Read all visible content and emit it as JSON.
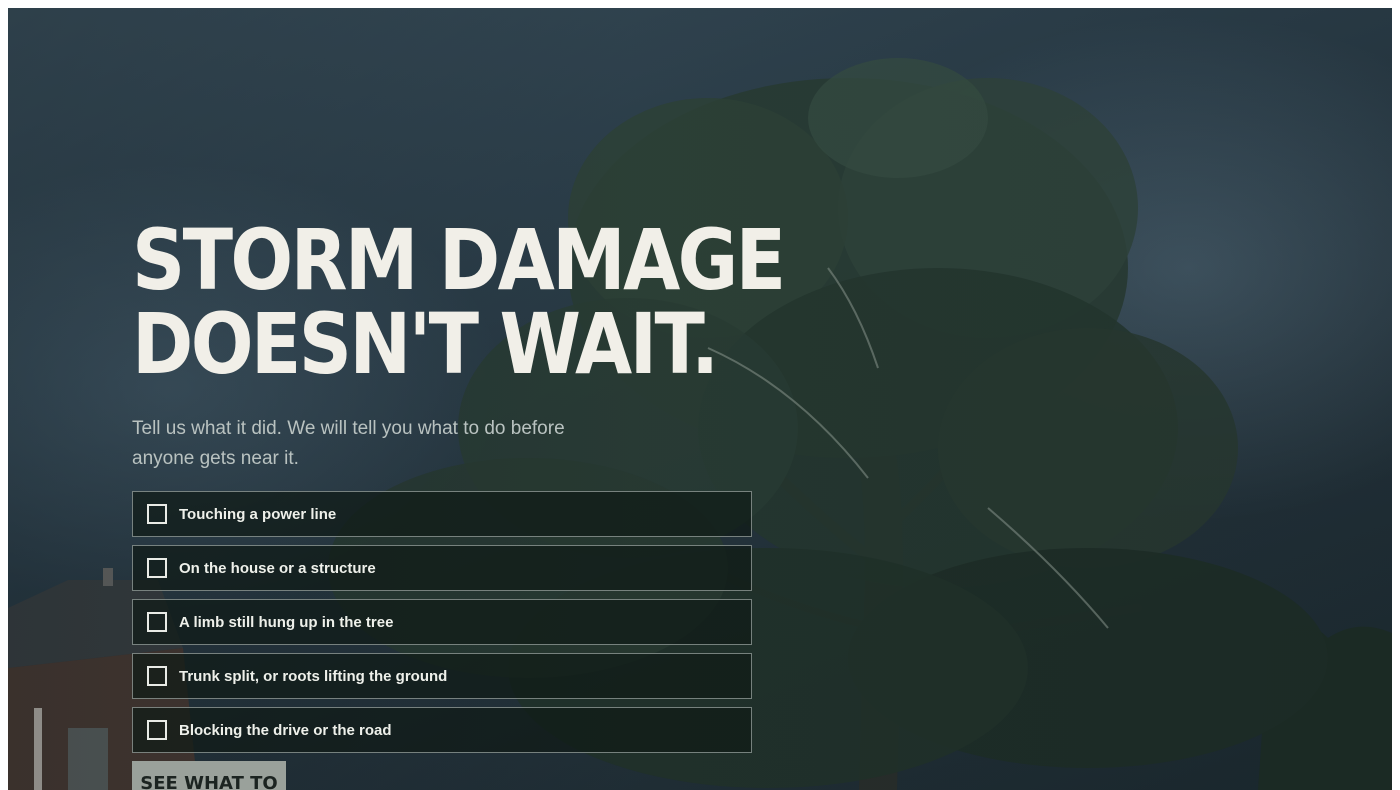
{
  "hero": {
    "headline_line1": "STORM DAMAGE",
    "headline_line2": "DOESN'T WAIT.",
    "subtitle": "Tell us what it did. We will tell you what to do before anyone gets near it."
  },
  "options": [
    {
      "label": "Touching a power line",
      "checked": false
    },
    {
      "label": "On the house or a structure",
      "checked": false
    },
    {
      "label": "A limb still hung up in the tree",
      "checked": false
    },
    {
      "label": "Trunk split, or roots lifting the ground",
      "checked": false
    },
    {
      "label": "Blocking the drive or the road",
      "checked": false
    }
  ],
  "cta": {
    "label": "SEE WHAT TO DO"
  },
  "colors": {
    "headline": "#f1efe8",
    "subtitle": "#b9c2c0",
    "option_background": "#0f1a16",
    "option_border": "#c8d2cd",
    "cta_background": "#9aa19b",
    "cta_text": "#1c2421"
  },
  "icons": {
    "checkbox": "empty-checkbox-icon"
  }
}
